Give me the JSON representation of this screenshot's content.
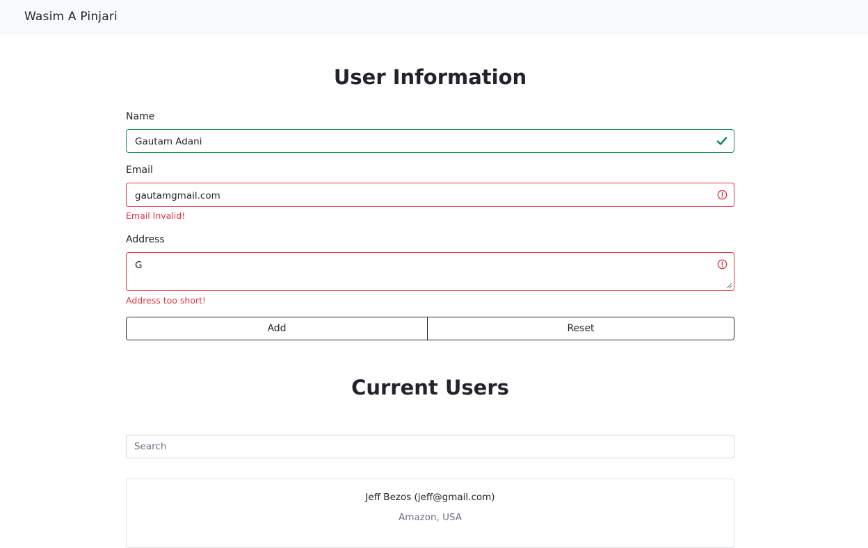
{
  "navbar": {
    "brand": "Wasim A Pinjari"
  },
  "form": {
    "title": "User Information",
    "name": {
      "label": "Name",
      "value": "Gautam Adani",
      "state": "valid"
    },
    "email": {
      "label": "Email",
      "value": "gautamgmail.com",
      "state": "invalid",
      "error": "Email Invalid!"
    },
    "address": {
      "label": "Address",
      "value": "G",
      "state": "invalid",
      "error": "Address too short!"
    },
    "buttons": {
      "add": "Add",
      "reset": "Reset"
    }
  },
  "users": {
    "title": "Current Users",
    "search_placeholder": "Search",
    "list": [
      {
        "title": "Jeff Bezos (jeff@gmail.com)",
        "subtitle": "Amazon, USA"
      }
    ]
  },
  "colors": {
    "valid": "#198754",
    "invalid": "#dc3545",
    "navbar_bg": "#f8f9fa",
    "muted": "#6c757d"
  }
}
